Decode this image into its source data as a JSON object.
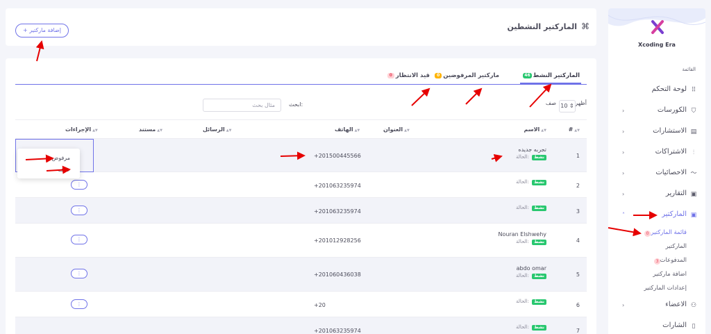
{
  "brand": {
    "name": "Xcoding Era"
  },
  "sidebar": {
    "caption": "القائمة",
    "items": [
      {
        "label": "لوحة التحكم",
        "icon": "grid-icon",
        "chevron": false
      },
      {
        "label": "الكورسات",
        "icon": "basket-icon",
        "chevron": true
      },
      {
        "label": "الاستشارات",
        "icon": "file-icon",
        "chevron": true
      },
      {
        "label": "الاشتراكات",
        "icon": "sitemap-icon",
        "chevron": true
      },
      {
        "label": "الاحصائيات",
        "icon": "chart-icon",
        "chevron": true
      },
      {
        "label": "التقارير",
        "icon": "box-icon",
        "chevron": true
      },
      {
        "label": "الماركتير",
        "icon": "box-icon",
        "chevron": true,
        "active": true
      }
    ],
    "subitems": [
      {
        "label": "قائمة الماركتير",
        "badge": "0",
        "active": true
      },
      {
        "label": "الماركتير",
        "badge": ""
      },
      {
        "label": "المدفوعات",
        "badge": "3"
      },
      {
        "label": "اضافة ماركتير",
        "badge": ""
      },
      {
        "label": "إعدادات الماركتير",
        "badge": ""
      }
    ],
    "items_after": [
      {
        "label": "الاعضاء",
        "icon": "users-icon",
        "chevron": true
      },
      {
        "label": "الشارات",
        "icon": "tag-icon",
        "chevron": false
      }
    ]
  },
  "header": {
    "title": "الماركتير النشطين",
    "add_button": "+ إضافة ماركتير"
  },
  "tabs": [
    {
      "label": "الماركتير النشط",
      "badge": "46",
      "badge_color": "#28c76f",
      "badge_text": "#ffffff",
      "active": true
    },
    {
      "label": "ماركتير المرفوضين",
      "badge": "0",
      "badge_color": "#ffb400",
      "badge_text": "#ffffff"
    },
    {
      "label": "قيد الانتظار",
      "badge": "0",
      "badge_color": "#ffd2d6",
      "badge_text": "#e8435a"
    }
  ],
  "controls": {
    "show_label": "أظهر",
    "rows_value": "10",
    "row_label": "صف",
    "search_label": "ابحث:",
    "search_placeholder": "مثال بحث"
  },
  "table": {
    "headers": [
      "#",
      "الاسم",
      "العنوان",
      "الهاتف",
      "الرسائل",
      "مستند",
      "الإجراءات"
    ],
    "status_label": "الحالة:",
    "status_value": "نشط",
    "action_glyph": "⋮",
    "rows": [
      {
        "num": "1",
        "name": "تجربه جديده",
        "phone": "+201500445566"
      },
      {
        "num": "2",
        "name": "",
        "phone": "+201063235974"
      },
      {
        "num": "3",
        "name": "",
        "phone": "+201063235974"
      },
      {
        "num": "4",
        "name": "Nouran Elshwehy",
        "phone": "+201012928256"
      },
      {
        "num": "5",
        "name": "abdo omar",
        "phone": "+201060436038"
      },
      {
        "num": "6",
        "name": "",
        "phone": "+20"
      },
      {
        "num": "7",
        "name": "",
        "phone": "+201063235974"
      }
    ]
  },
  "dropdown": {
    "items": [
      "مرفوض",
      "حذف"
    ]
  },
  "colors": {
    "accent": "#6f72e8",
    "active_green": "#28c76f",
    "annotation": "#e60000"
  }
}
